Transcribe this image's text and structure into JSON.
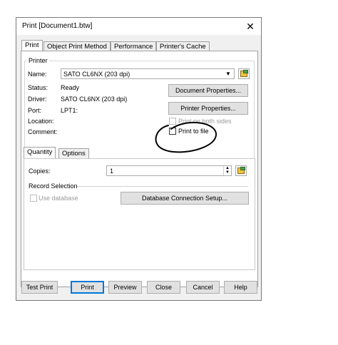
{
  "window": {
    "title": "Print [Document1.btw]",
    "close_symbol": "✕"
  },
  "tabs": [
    "Print",
    "Object Print Method",
    "Performance",
    "Printer's Cache"
  ],
  "printer": {
    "group_label": "Printer",
    "name_label": "Name:",
    "name_value": "SATO CL6NX (203 dpi)",
    "status_label": "Status:",
    "status_value": "Ready",
    "driver_label": "Driver:",
    "driver_value": "SATO CL6NX (203 dpi)",
    "port_label": "Port:",
    "port_value": "LPT1:",
    "location_label": "Location:",
    "comment_label": "Comment:",
    "document_properties": "Document Properties...",
    "printer_properties": "Printer Properties...",
    "print_both_sides": "Print on both sides",
    "print_to_file": "Print to file"
  },
  "subtabs": [
    "Quantity",
    "Options"
  ],
  "quantity": {
    "copies_label": "Copies:",
    "copies_value": "1",
    "record_selection_label": "Record Selection",
    "use_database": "Use database",
    "db_setup": "Database Connection Setup..."
  },
  "footer": {
    "test_print": "Test Print",
    "print": "Print",
    "preview": "Preview",
    "close": "Close",
    "cancel": "Cancel",
    "help": "Help"
  },
  "annotation_color": "#000000"
}
